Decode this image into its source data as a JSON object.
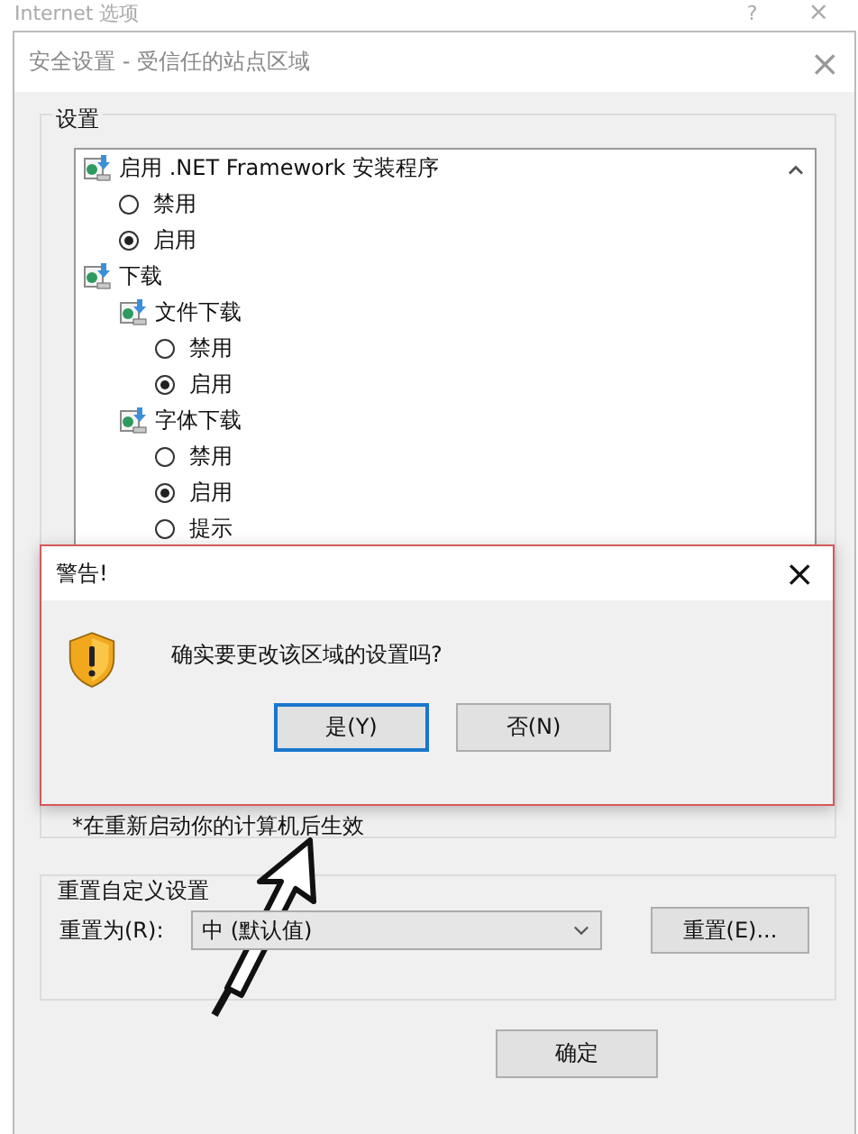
{
  "outer_window": {
    "title": "Internet 选项",
    "help": "?",
    "close": "×"
  },
  "dialog": {
    "title": "安全设置 - 受信任的站点区域",
    "close": "×"
  },
  "settings": {
    "title": "设置",
    "items": [
      {
        "kind": "group",
        "label": "启用 .NET Framework 安装程序",
        "children": [
          {
            "kind": "radio",
            "label": "禁用",
            "selected": false
          },
          {
            "kind": "radio",
            "label": "启用",
            "selected": true
          }
        ]
      },
      {
        "kind": "group",
        "label": "下载",
        "children": [
          {
            "kind": "group",
            "label": "文件下载",
            "children": [
              {
                "kind": "radio",
                "label": "禁用",
                "selected": false
              },
              {
                "kind": "radio",
                "label": "启用",
                "selected": true
              }
            ]
          },
          {
            "kind": "group",
            "label": "字体下载",
            "children": [
              {
                "kind": "radio",
                "label": "禁用",
                "selected": false
              },
              {
                "kind": "radio",
                "label": "启用",
                "selected": true
              },
              {
                "kind": "radio",
                "label": "提示",
                "selected": false
              }
            ]
          }
        ]
      }
    ],
    "note": "*在重新启动你的计算机后生效"
  },
  "alert": {
    "title": "警告!",
    "close": "×",
    "message": "确实要更改该区域的设置吗?",
    "buttons": [
      {
        "label": "是(Y)",
        "selected": true
      },
      {
        "label": "否(N)",
        "selected": false
      }
    ]
  },
  "reset": {
    "title": "重置自定义设置",
    "label": "重置为(R):",
    "value": "中 (默认值)",
    "button": "重置(E)..."
  },
  "footer": {
    "ok": "确定"
  }
}
